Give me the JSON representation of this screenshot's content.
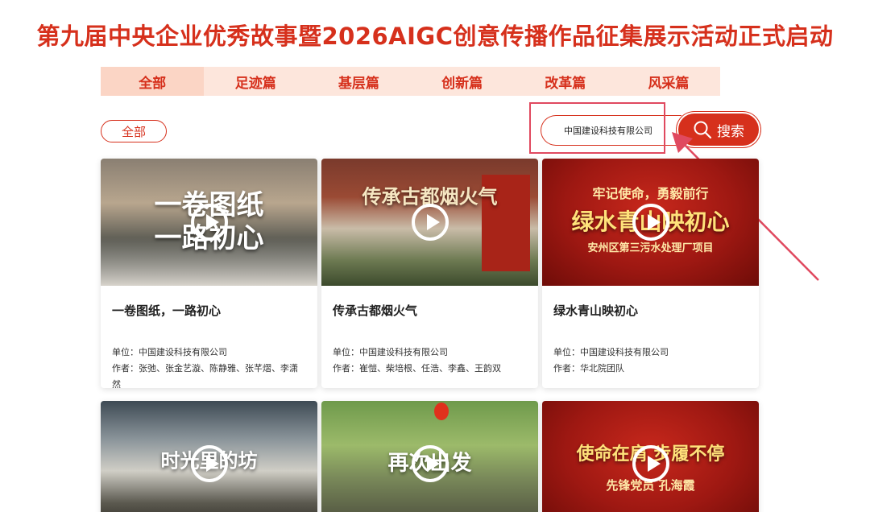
{
  "page": {
    "title": "第九届中央企业优秀故事暨2026AIGC创意传播作品征集展示活动正式启动"
  },
  "tabs": [
    {
      "label": "全部"
    },
    {
      "label": "足迹篇"
    },
    {
      "label": "基层篇"
    },
    {
      "label": "创新篇"
    },
    {
      "label": "改革篇"
    },
    {
      "label": "风采篇"
    }
  ],
  "filter": {
    "label": "全部"
  },
  "search": {
    "value": "中国建设科技有限公司",
    "button_label": "搜索"
  },
  "cards": [
    {
      "thumb_text": "一卷图纸\n一路初心",
      "title": "一卷图纸，一路初心",
      "unit": "单位：中国建设科技有限公司",
      "authors": "作者：张弛、张金艺漩、陈静雅、张芊熠、李潇然"
    },
    {
      "thumb_text": "传承古都烟火气",
      "title": "传承古都烟火气",
      "unit": "单位：中国建设科技有限公司",
      "authors": "作者：崔愷、柴培根、任浩、李鑫、王韵双"
    },
    {
      "thumb_text": "绿水青山映初心",
      "thumb_top": "牢记使命，勇毅前行",
      "thumb_bottom": "安州区第三污水处理厂项目",
      "title": "绿水青山映初心",
      "unit": "单位：中国建设科技有限公司",
      "authors": "作者：华北院团队"
    },
    {
      "thumb_text": "时光里的坊"
    },
    {
      "thumb_text": "再次出发"
    },
    {
      "thumb_text": "使命在肩 步履不停",
      "thumb_bottom": "先锋党员 孔海霞"
    }
  ],
  "colors": {
    "accent": "#d6301c",
    "tab_bg": "#fde6dc",
    "annotation": "#e0495f"
  }
}
